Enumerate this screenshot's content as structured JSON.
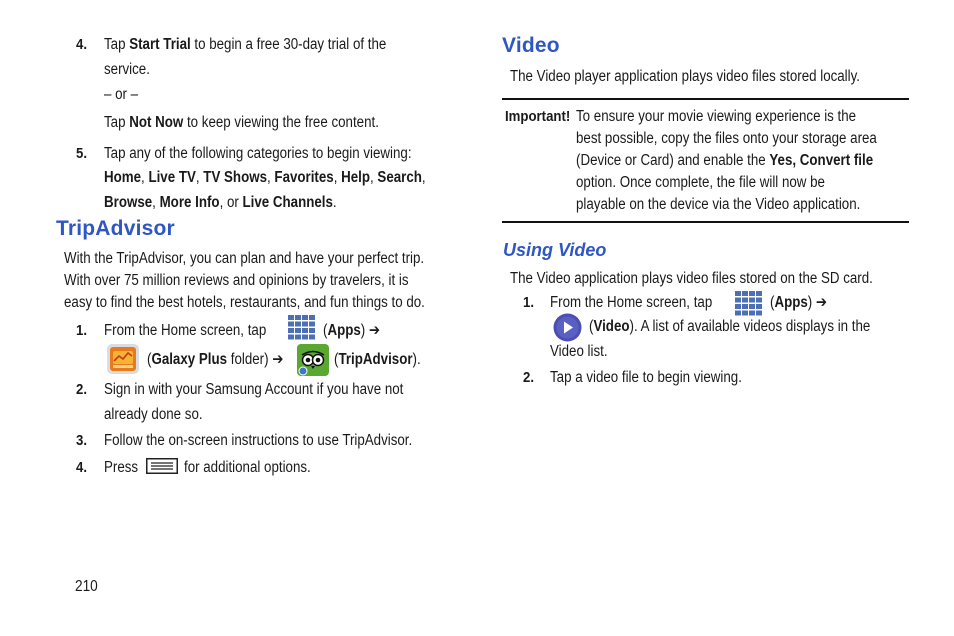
{
  "left": {
    "step4_num": "4.",
    "step4_line1_a": "Tap ",
    "step4_line1_b": "Start Trial",
    "step4_line1_c": " to begin a free 30-day trial of the",
    "step4_line2": "service.",
    "or_text": "– or –",
    "alt_a": "Tap ",
    "alt_b": "Not Now",
    "alt_c": " to keep viewing the free content.",
    "step5_num": "5.",
    "step5_line1": "Tap any of the following categories to begin viewing:",
    "cat_home": "Home",
    "cat_livetv": "Live TV",
    "cat_tvshows": "TV Shows",
    "cat_favorites": "Favorites",
    "cat_help": "Help",
    "cat_search": "Search",
    "cat_browse": "Browse",
    "cat_moreinfo": "More Info",
    "cat_livechannels": "Live Channels",
    "comma": ", ",
    "or_word": ", or ",
    "period": ".",
    "trip_title": "TripAdvisor",
    "trip_p1": "With the TripAdvisor, you can plan and have your perfect trip.",
    "trip_p2": "With over 75 million reviews and opinions by travelers, it is",
    "trip_p3": "easy to find the best hotels, restaurants, and fun things to do.",
    "t1_num": "1.",
    "t1_a": "From the Home screen, tap",
    "t1_apps_open": "(",
    "t1_apps": "Apps",
    "t1_apps_close": ") ➔",
    "t1_gp_open": "(",
    "t1_gp": "Galaxy Plus",
    "t1_gp_rest": " folder) ➔",
    "t1_ta_open": "(",
    "t1_ta": "TripAdvisor",
    "t1_ta_close": ").",
    "t2_num": "2.",
    "t2_line1": "Sign in with your Samsung Account if you have not",
    "t2_line2": "already done so.",
    "t3_num": "3.",
    "t3_line": "Follow the on-screen instructions to use TripAdvisor.",
    "t4_num": "4.",
    "t4_a": "Press",
    "t4_b": "for additional options."
  },
  "right": {
    "video_title": "Video",
    "video_intro": "The Video player application plays video files stored locally.",
    "important_label": "Important!",
    "imp_l1": "To ensure your movie viewing experience is the",
    "imp_l2": "best possible, copy the files onto your storage area",
    "imp_l3a": "(Device or Card) and enable the ",
    "imp_l3b": "Yes, Convert file",
    "imp_l4": "option. Once complete, the file will now be",
    "imp_l5": "playable on the device via the Video application.",
    "using_title": "Using Video",
    "using_intro": "The Video application plays video files stored on the SD card.",
    "u1_num": "1.",
    "u1_a": "From the Home screen, tap",
    "u1_apps_open": "(",
    "u1_apps": "Apps",
    "u1_apps_close": ") ➔",
    "u1_video_open": "(",
    "u1_video": "Video",
    "u1_video_rest": "). A list of available videos displays in the",
    "u1_line3": "Video list.",
    "u2_num": "2.",
    "u2_line": "Tap a video file to begin viewing."
  },
  "page_number": "210",
  "colors": {
    "heading": "#2f57c4",
    "apps_icon": "#4d6fb3",
    "trip_green": "#5aa832"
  },
  "icons": [
    "apps-icon",
    "galaxy-plus-icon",
    "tripadvisor-icon",
    "menu-key-icon",
    "video-icon"
  ]
}
